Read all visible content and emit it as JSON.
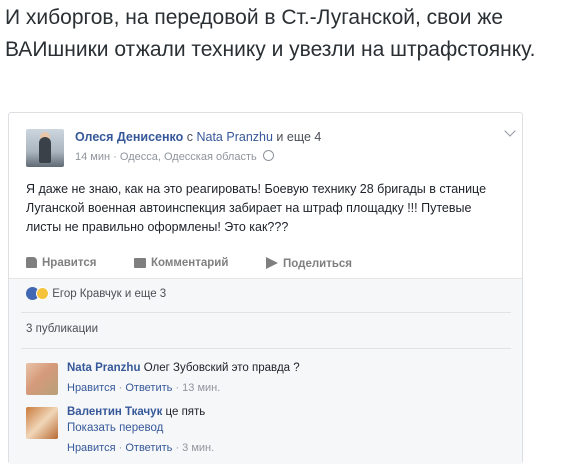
{
  "headline": "И хиборгов, на передовой в Ст.-Луганской, свои же ВАИшники отжали технику и увезли на штрафстоянку.",
  "post": {
    "author": "Олеся Денисенко",
    "with_word": "с",
    "tagged": "Nata Pranzhu",
    "and_more": "и еще 4",
    "time": "14 мин",
    "separator": "·",
    "location": "Одесса, Одесская область",
    "text": "Я даже не знаю, как на это реагировать! Боевую технику 28 бригады в станице Луганской военная автоинспекция забирает на штраф площадку !!! Путевые листы не правильно оформлены! Это как???"
  },
  "actions": {
    "like": "Нравится",
    "comment": "Комментарий",
    "share": "Поделиться"
  },
  "reactions": {
    "text": "Егор Кравчук и еще 3"
  },
  "shares": "3 публикации",
  "comments": [
    {
      "author": "Nata Pranzhu",
      "text": "Олег Зубовский это правда ?",
      "like": "Нравится",
      "reply": "Ответить",
      "dot": "·",
      "time": "13 мин."
    },
    {
      "author": "Валентин Ткачук",
      "text": "це пять",
      "translate": "Показать перевод",
      "like": "Нравится",
      "reply": "Ответить",
      "dot": "·",
      "time": "3 мин."
    }
  ],
  "colors": {
    "link": "#365899",
    "muted": "#90949c",
    "action": "#7f7f7f",
    "background_gray": "#f6f7f9"
  },
  "icons": [
    "chevron-down-icon",
    "globe-icon",
    "like-icon",
    "comment-icon",
    "share-icon",
    "like-reaction-icon",
    "sad-reaction-icon"
  ]
}
